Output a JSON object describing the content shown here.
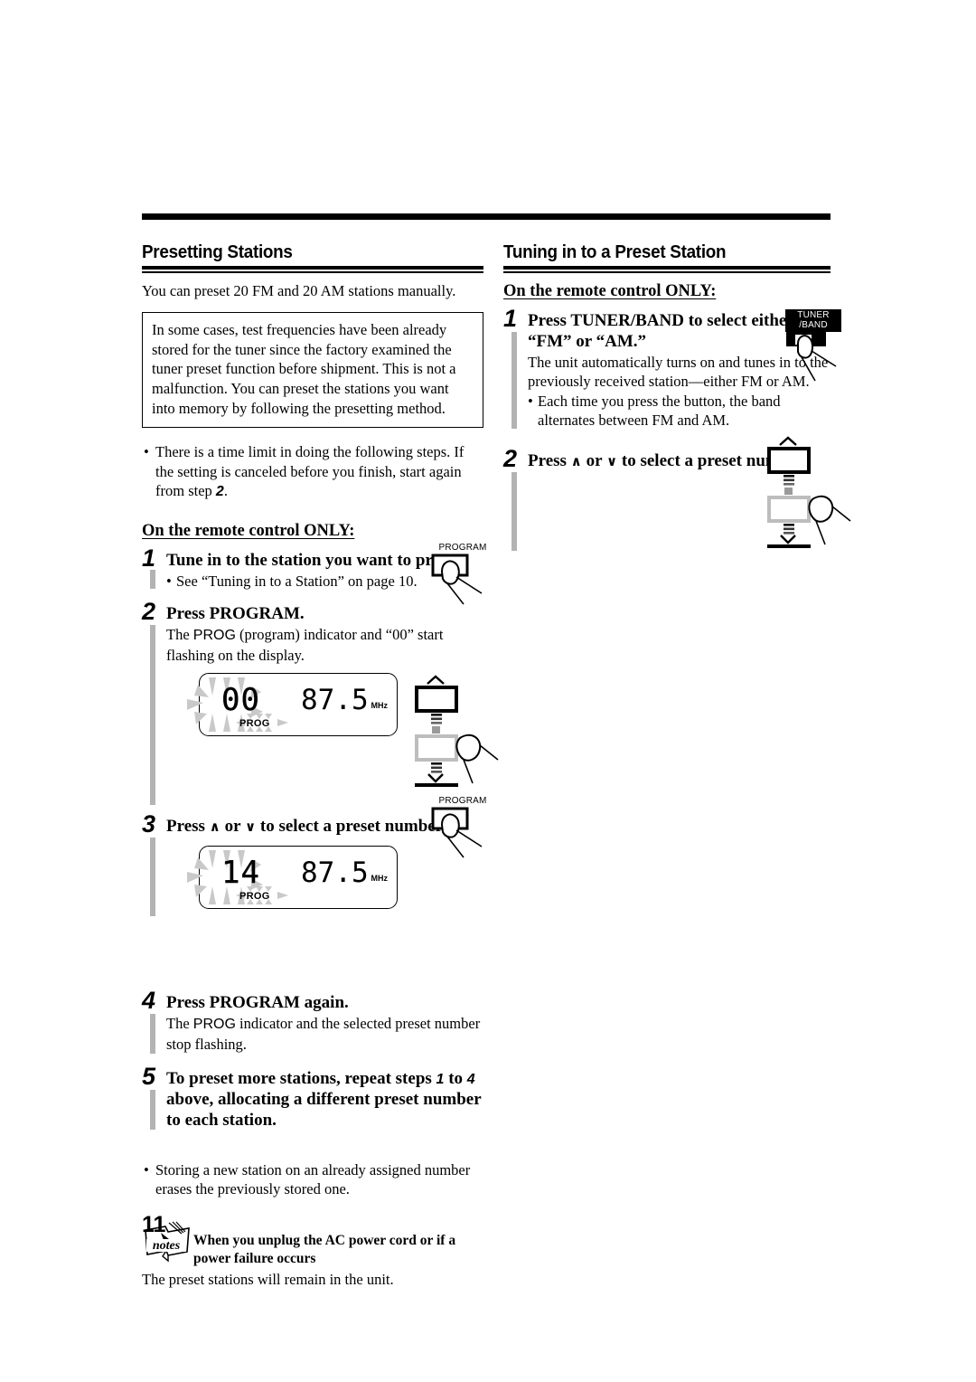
{
  "page": {
    "number": "11"
  },
  "left_column": {
    "heading": "Presetting Stations",
    "intro": "You can preset 20 FM and 20 AM stations manually.",
    "framed_note": "In some cases, test frequencies have been already stored for the tuner since the factory examined the tuner preset function before shipment. This is not a malfunction. You can preset the stations you want into memory by following the presetting method.",
    "time_limit_bullet_a": "There is a time limit in doing the following steps. If the setting is canceled before you finish, start again from step",
    "time_limit_bullet_step": "2",
    "time_limit_bullet_b": ".",
    "remote_only": "On the remote control ONLY:",
    "steps": [
      {
        "num": "1",
        "title": "Tune in to the station you want to preset.",
        "sub_bullet": "See “Tuning in to a Station” on page 10."
      },
      {
        "num": "2",
        "title": "Press PROGRAM.",
        "desc_a": "The ",
        "desc_ind": "PROG",
        "desc_b": " (program) indicator and “00” start flashing on the display.",
        "button_label_line1": "PROGRAM"
      },
      {
        "num": "3",
        "title_a": "Press ",
        "title_up": "∧",
        "title_mid": " or ",
        "title_down": "∨",
        "title_b": " to select a preset number."
      },
      {
        "num": "4",
        "title": "Press PROGRAM again.",
        "desc_a": "The ",
        "desc_ind": "PROG",
        "desc_b": " indicator and the selected preset number stop flashing.",
        "button_label_line1": "PROGRAM"
      },
      {
        "num": "5",
        "title_a": "To preset more stations, repeat steps ",
        "title_s1": "1",
        "title_mid": " to ",
        "title_s2": "4",
        "title_b": " above, allocating a different preset number to each station."
      }
    ],
    "closing_bullet": "Storing a new station on an already assigned number erases the previously stored one.",
    "notes": {
      "icon_label": "notes",
      "title": "When you unplug the AC power cord or if a power failure occurs",
      "body": "The preset stations will remain in the unit."
    },
    "displays": [
      {
        "preset": "00",
        "freq": "87.5",
        "unit": "MHz",
        "prog": "PROG"
      },
      {
        "preset": "14",
        "freq": "87.5",
        "unit": "MHz",
        "prog": "PROG"
      }
    ]
  },
  "right_column": {
    "heading": "Tuning in to a Preset Station",
    "remote_only": "On the remote control ONLY:",
    "steps": [
      {
        "num": "1",
        "title_line1": "Press TUNER/BAND to select either",
        "title_line2": "“FM” or “AM.”",
        "desc": "The unit automatically turns on and tunes in to the previously received station—either FM or AM.",
        "sub_bullet": "Each time you press the button, the band alternates between FM and AM.",
        "button_label_line1": "TUNER",
        "button_label_line2": "/BAND"
      },
      {
        "num": "2",
        "title_a": "Press ",
        "title_up": "∧",
        "title_mid": " or ",
        "title_down": "∨",
        "title_b": " to select a preset number."
      }
    ]
  },
  "colors": {
    "ink": "#000000",
    "step_bar": "#b3b3b3",
    "flash": "#c9c9c9",
    "paper": "#ffffff"
  }
}
